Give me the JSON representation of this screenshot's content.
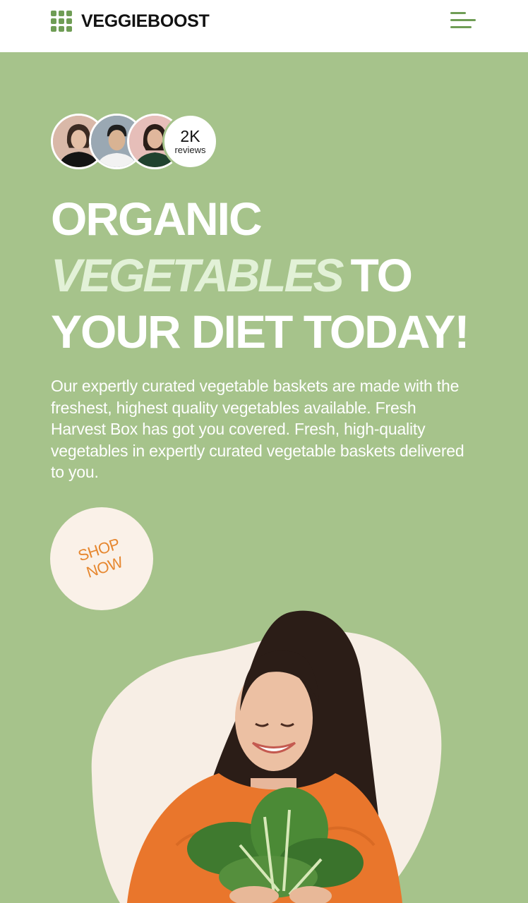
{
  "header": {
    "logo_text": "VEGGIEBOOST",
    "logo_icon": "grid-icon",
    "menu_icon": "hamburger-menu-icon"
  },
  "reviews": {
    "count": "2K",
    "label": "reviews"
  },
  "headline": {
    "line1": "ORGANIC",
    "highlight": "VEGETABLES",
    "line2_rest": "TO",
    "line3": "YOUR DIET TODAY!"
  },
  "description": "Our expertly curated vegetable baskets are made with the freshest, highest quality vegetables available. Fresh Harvest Box has got you covered. Fresh, high-quality vegetables in expertly curated vegetable baskets delivered to you.",
  "cta": {
    "line1": "SHOP",
    "line2": "NOW"
  },
  "colors": {
    "background": "#a6c38b",
    "header_bg": "#ffffff",
    "accent_green": "#6f9d55",
    "cta_bg": "#faf1e8",
    "cta_text": "#e6872f",
    "highlight_text": "#e2f1d7"
  }
}
